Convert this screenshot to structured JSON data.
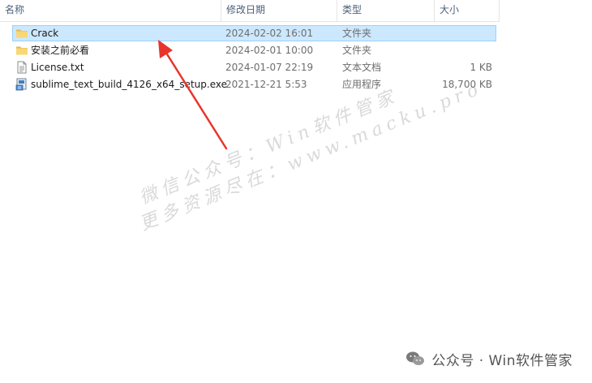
{
  "columns": {
    "name": "名称",
    "date": "修改日期",
    "type": "类型",
    "size": "大小"
  },
  "files": [
    {
      "name": "Crack",
      "date": "2024-02-02 16:01",
      "type": "文件夹",
      "size": "",
      "icon": "folder-icon",
      "selected": true
    },
    {
      "name": "安装之前必看",
      "date": "2024-02-01 10:00",
      "type": "文件夹",
      "size": "",
      "icon": "folder-icon",
      "selected": false
    },
    {
      "name": "License.txt",
      "date": "2024-01-07 22:19",
      "type": "文本文档",
      "size": "1 KB",
      "icon": "text-file-icon",
      "selected": false
    },
    {
      "name": "sublime_text_build_4126_x64_setup.exe",
      "date": "2021-12-21 5:53",
      "type": "应用程序",
      "size": "18,700 KB",
      "icon": "installer-icon",
      "selected": false
    }
  ],
  "watermark": {
    "line1": "微信公众号：Win软件管家",
    "line2": "更多资源尽在：www.macku.pro"
  },
  "brand": {
    "text": "公众号 · Win软件管家"
  },
  "colors": {
    "selection": "#cce8ff",
    "selection_border": "#99d1ff",
    "folder": "#f8d775",
    "arrow": "#e8352b"
  }
}
